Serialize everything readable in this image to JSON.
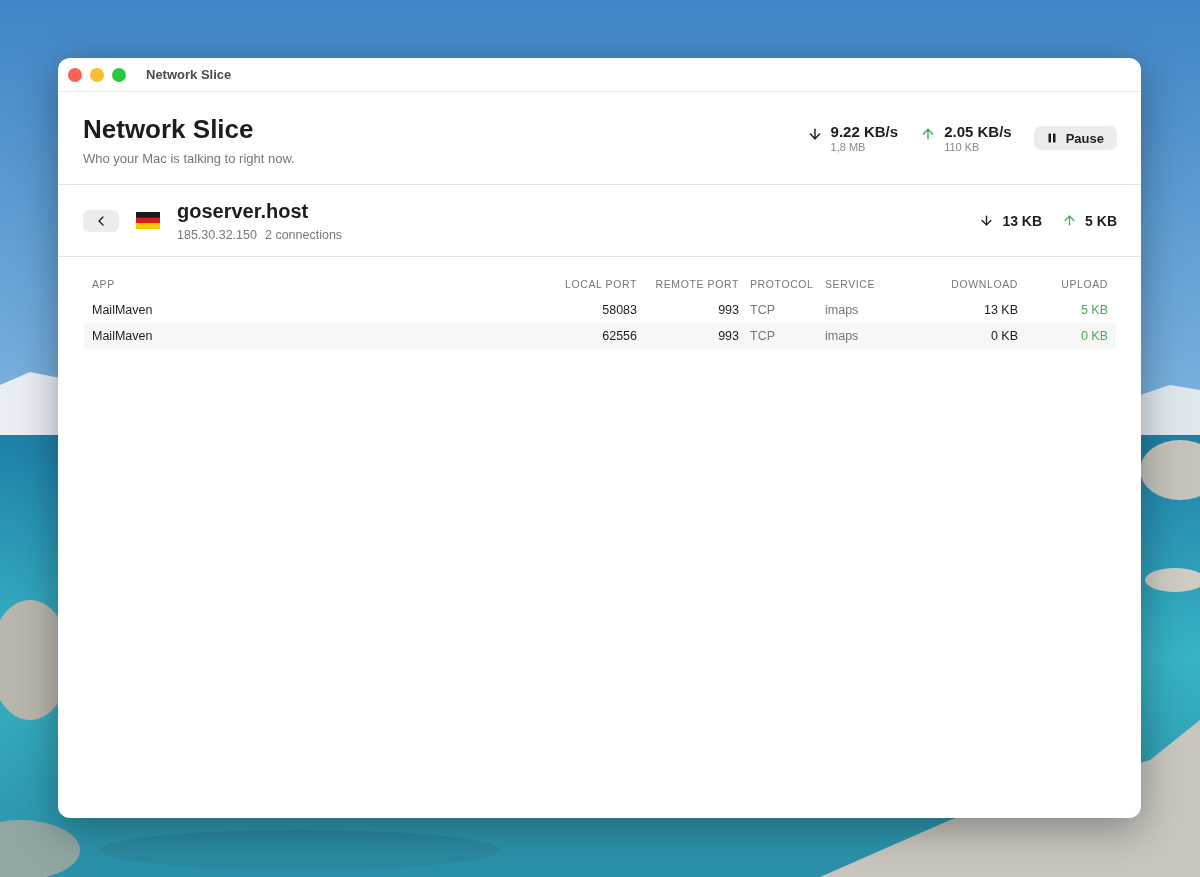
{
  "window": {
    "title": "Network Slice"
  },
  "header": {
    "title": "Network Slice",
    "subtitle": "Who your Mac is talking to right now.",
    "download": {
      "rate": "9.22 KB/s",
      "total": "1,8 MB"
    },
    "upload": {
      "rate": "2.05 KB/s",
      "total": "110 KB"
    },
    "pause_button": "Pause"
  },
  "host": {
    "name": "goserver.host",
    "address": "185.30.32.150",
    "connections": "2 connections",
    "download": "13 KB",
    "upload": "5 KB"
  },
  "table": {
    "columns": [
      "APP",
      "LOCAL PORT",
      "REMOTE PORT",
      "PROTOCOL",
      "SERVICE",
      "DOWNLOAD",
      "UPLOAD"
    ],
    "rows": [
      {
        "app": "MailMaven",
        "local_port": "58083",
        "remote_port": "993",
        "protocol": "TCP",
        "service": "imaps",
        "download": "13 KB",
        "upload": "5 KB"
      },
      {
        "app": "MailMaven",
        "local_port": "62556",
        "remote_port": "993",
        "protocol": "TCP",
        "service": "imaps",
        "download": "0 KB",
        "upload": "0 KB"
      }
    ]
  }
}
